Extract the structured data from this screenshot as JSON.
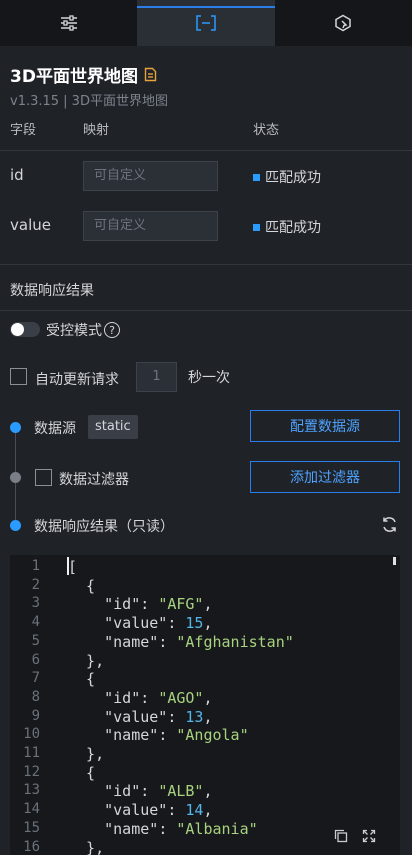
{
  "tabs": [
    {
      "icon": "sliders-icon",
      "active": false
    },
    {
      "icon": "data-bracket-icon",
      "active": true
    },
    {
      "icon": "interaction-icon",
      "active": false
    }
  ],
  "component": {
    "title": "3D平面世界地图",
    "version": "v1.3.15 | 3D平面世界地图"
  },
  "fields_table": {
    "headers": [
      "字段",
      "映射",
      "状态"
    ],
    "rows": [
      {
        "field": "id",
        "placeholder": "可自定义",
        "status": "匹配成功"
      },
      {
        "field": "value",
        "placeholder": "可自定义",
        "status": "匹配成功"
      }
    ]
  },
  "response": {
    "section_title": "数据响应结果",
    "controlled_mode_label": "受控模式",
    "auto_update_label": "自动更新请求",
    "interval_value": "1",
    "interval_unit": "秒一次",
    "datasource_label": "数据源",
    "datasource_tag": "static",
    "configure_button": "配置数据源",
    "filter_label": "数据过滤器",
    "add_filter_button": "添加过滤器",
    "result_label": "数据响应结果（只读）"
  },
  "code_lines": [
    "[",
    "  {",
    "    \"id\": \"AFG\",",
    "    \"value\": 15,",
    "    \"name\": \"Afghanistan\"",
    "  },",
    "  {",
    "    \"id\": \"AGO\",",
    "    \"value\": 13,",
    "    \"name\": \"Angola\"",
    "  },",
    "  {",
    "    \"id\": \"ALB\",",
    "    \"value\": 14,",
    "    \"name\": \"Albania\"",
    "  },"
  ],
  "colors": {
    "accent": "#2b7dea",
    "success_dot": "#2b9cff",
    "string": "#a8d27e",
    "number": "#56b6e8"
  }
}
